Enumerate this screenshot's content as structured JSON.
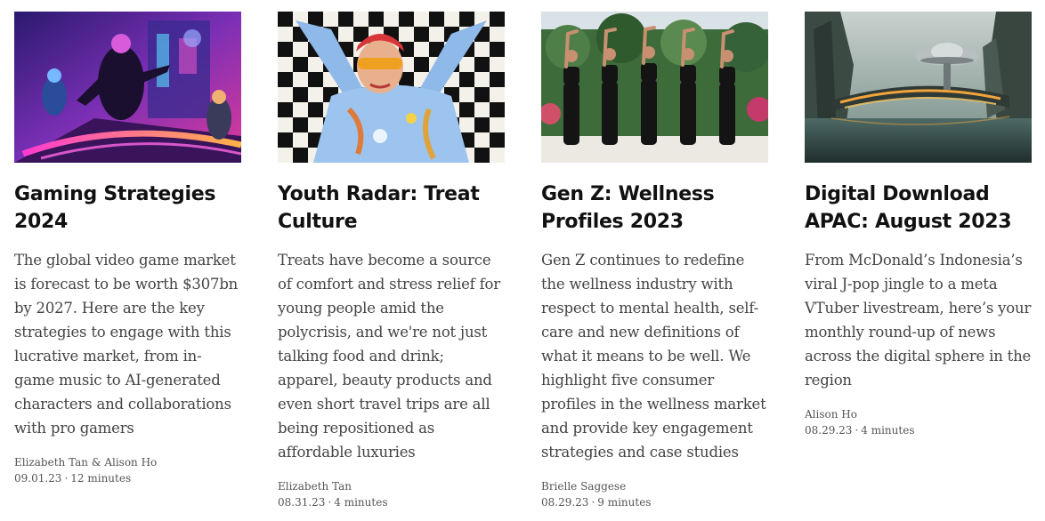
{
  "articles": [
    {
      "title": "Gaming Strategies 2024",
      "excerpt": "The global video game market is forecast to be worth $307bn by 2027. Here are the key strategies to engage with this lucrative market, from in-game music to AI-generated characters and collaborations with pro gamers",
      "author": "Elizabeth Tan & Alison Ho",
      "date": "09.01.23",
      "read_time": "12 minutes"
    },
    {
      "title": "Youth Radar: Treat Culture",
      "excerpt": "Treats have become a source of comfort and stress relief for young people amid the polycrisis, and we're not just talking food and drink; apparel, beauty products and even short travel trips are all being repositioned as affordable luxuries",
      "author": "Elizabeth Tan",
      "date": "08.31.23",
      "read_time": "4 minutes"
    },
    {
      "title": "Gen Z: Wellness Profiles 2023",
      "excerpt": "Gen Z continues to redefine the wellness industry with respect to mental health, self-care and new definitions of what it means to be well. We highlight five consumer profiles in the wellness market and provide key engagement strategies and case studies",
      "author": "Brielle Saggese",
      "date": "08.29.23",
      "read_time": "9 minutes"
    },
    {
      "title": "Digital Download APAC: August 2023",
      "excerpt": "From McDonald’s Indonesia’s viral J-pop jingle to a meta VTuber livestream, here’s your monthly round-up of news across the digital sphere in the region",
      "author": "Alison Ho",
      "date": "08.29.23",
      "read_time": "4 minutes"
    }
  ],
  "meta_separator": "·"
}
